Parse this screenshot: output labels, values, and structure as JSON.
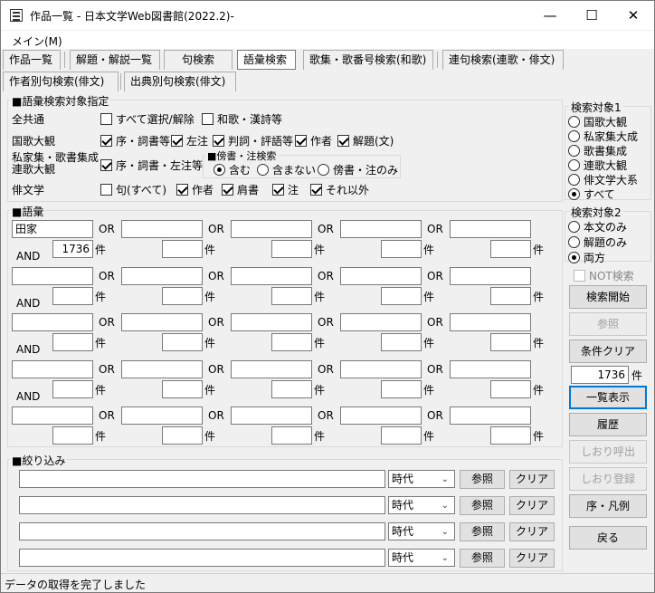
{
  "window": {
    "title": "作品一覧 - 日本文学Web図書館(2022.2)-",
    "minimize": "—",
    "maximize": "☐",
    "close": "✕"
  },
  "menu": {
    "main": "メイン(M)"
  },
  "tabs_row1": [
    "作品一覧",
    "解題・解説一覧",
    "句検索",
    "語彙検索",
    "歌集・歌番号検索(和歌)",
    "連句検索(連歌・俳文)"
  ],
  "tabs_row2": [
    "作者別句検索(俳文)",
    "出典別句検索(俳文)"
  ],
  "active_tab": "語彙検索",
  "target_section": {
    "legend": "■語彙検索対象指定",
    "rows": [
      {
        "label": "全共通",
        "options": [
          {
            "label": "すべて選択/解除",
            "checked": false
          },
          {
            "label": "和歌・漢詩等",
            "checked": false
          }
        ]
      },
      {
        "label": "国歌大観",
        "options": [
          {
            "label": "序・詞書等",
            "checked": true
          },
          {
            "label": "左注",
            "checked": true
          },
          {
            "label": "判詞・評語等",
            "checked": true
          },
          {
            "label": "作者",
            "checked": true
          },
          {
            "label": "解題(文)",
            "checked": true
          }
        ]
      },
      {
        "label": "私家集・歌書集成",
        "label2": "連歌大観",
        "options": [
          {
            "label": "序・詞書・左注等",
            "checked": true
          }
        ]
      },
      {
        "label": "俳文学",
        "options": [
          {
            "label": "句(すべて)",
            "checked": false
          },
          {
            "label": "作者",
            "checked": true
          },
          {
            "label": "肩書",
            "checked": true
          },
          {
            "label": "注",
            "checked": true
          },
          {
            "label": "それ以外",
            "checked": true
          }
        ]
      }
    ],
    "bosho": {
      "legend": "■傍書・注検索",
      "options": [
        {
          "label": "含む",
          "selected": true
        },
        {
          "label": "含まない",
          "selected": false
        },
        {
          "label": "傍書・注のみ",
          "selected": false
        }
      ]
    }
  },
  "vocab_section": {
    "legend": "■語彙",
    "or_label": "OR",
    "and_label": "AND",
    "count_suffix": "件",
    "rows": [
      {
        "terms": [
          "田家",
          "",
          "",
          "",
          ""
        ],
        "counts": [
          "1736",
          "",
          "",
          "",
          ""
        ]
      },
      {
        "terms": [
          "",
          "",
          "",
          "",
          ""
        ],
        "counts": [
          "",
          "",
          "",
          "",
          ""
        ]
      },
      {
        "terms": [
          "",
          "",
          "",
          "",
          ""
        ],
        "counts": [
          "",
          "",
          "",
          "",
          ""
        ]
      },
      {
        "terms": [
          "",
          "",
          "",
          "",
          ""
        ],
        "counts": [
          "",
          "",
          "",
          "",
          ""
        ]
      },
      {
        "terms": [
          "",
          "",
          "",
          "",
          ""
        ],
        "counts": [
          "",
          "",
          "",
          "",
          ""
        ]
      }
    ]
  },
  "filter_section": {
    "legend": "■絞り込み",
    "rows": [
      {
        "value": "",
        "select": "時代",
        "ref": "参照",
        "clear": "クリア"
      },
      {
        "value": "",
        "select": "時代",
        "ref": "参照",
        "clear": "クリア"
      },
      {
        "value": "",
        "select": "時代",
        "ref": "参照",
        "clear": "クリア"
      },
      {
        "value": "",
        "select": "時代",
        "ref": "参照",
        "clear": "クリア"
      }
    ]
  },
  "search_target1": {
    "legend": "検索対象1",
    "options": [
      {
        "label": "国歌大観",
        "selected": false
      },
      {
        "label": "私家集大成",
        "selected": false
      },
      {
        "label": "歌書集成",
        "selected": false
      },
      {
        "label": "連歌大観",
        "selected": false
      },
      {
        "label": "俳文学大系",
        "selected": false
      },
      {
        "label": "すべて",
        "selected": true
      }
    ]
  },
  "search_target2": {
    "legend": "検索対象2",
    "options": [
      {
        "label": "本文のみ",
        "selected": false
      },
      {
        "label": "解題のみ",
        "selected": false
      },
      {
        "label": "両方",
        "selected": true
      }
    ]
  },
  "side": {
    "not_search": "NOT検索",
    "search_start": "検索開始",
    "ref": "参照",
    "clear_conditions": "条件クリア",
    "total_count": "1736",
    "count_suffix": "件",
    "list_view": "一覧表示",
    "history": "履歴",
    "bookmark_call": "しおり呼出",
    "bookmark_save": "しおり登録",
    "preface": "序・凡例",
    "back": "戻る"
  },
  "status": {
    "text": "データの取得を完了しました"
  }
}
